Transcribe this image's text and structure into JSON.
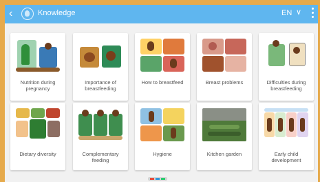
{
  "header": {
    "title": "Knowledge",
    "language": "EN",
    "back_icon": "back-arrow-icon",
    "menu_icon": "more-vert-icon"
  },
  "cards": [
    {
      "label": "Nutrition during pregnancy",
      "icon": "nutrition-illustration"
    },
    {
      "label": "Importance of breastfeeding",
      "icon": "breastfeeding-illustration"
    },
    {
      "label": "How to breastfeed",
      "icon": "how-to-breastfeed-illustration"
    },
    {
      "label": "Breast problems",
      "icon": "breast-problems-photo"
    },
    {
      "label": "Difficulties during breastfeeding",
      "icon": "difficulties-illustration"
    },
    {
      "label": "Dietary diversity",
      "icon": "dietary-diversity-illustration"
    },
    {
      "label": "Complementary feeding",
      "icon": "complementary-feeding-illustration"
    },
    {
      "label": "Hygiene",
      "icon": "hygiene-illustration"
    },
    {
      "label": "Kitchen garden",
      "icon": "kitchen-garden-photo"
    },
    {
      "label": "Early child development",
      "icon": "child-development-illustration"
    }
  ],
  "colors": {
    "frame": "#e6aa4c",
    "header": "#5fb6ef",
    "background": "#f1f1f1"
  }
}
